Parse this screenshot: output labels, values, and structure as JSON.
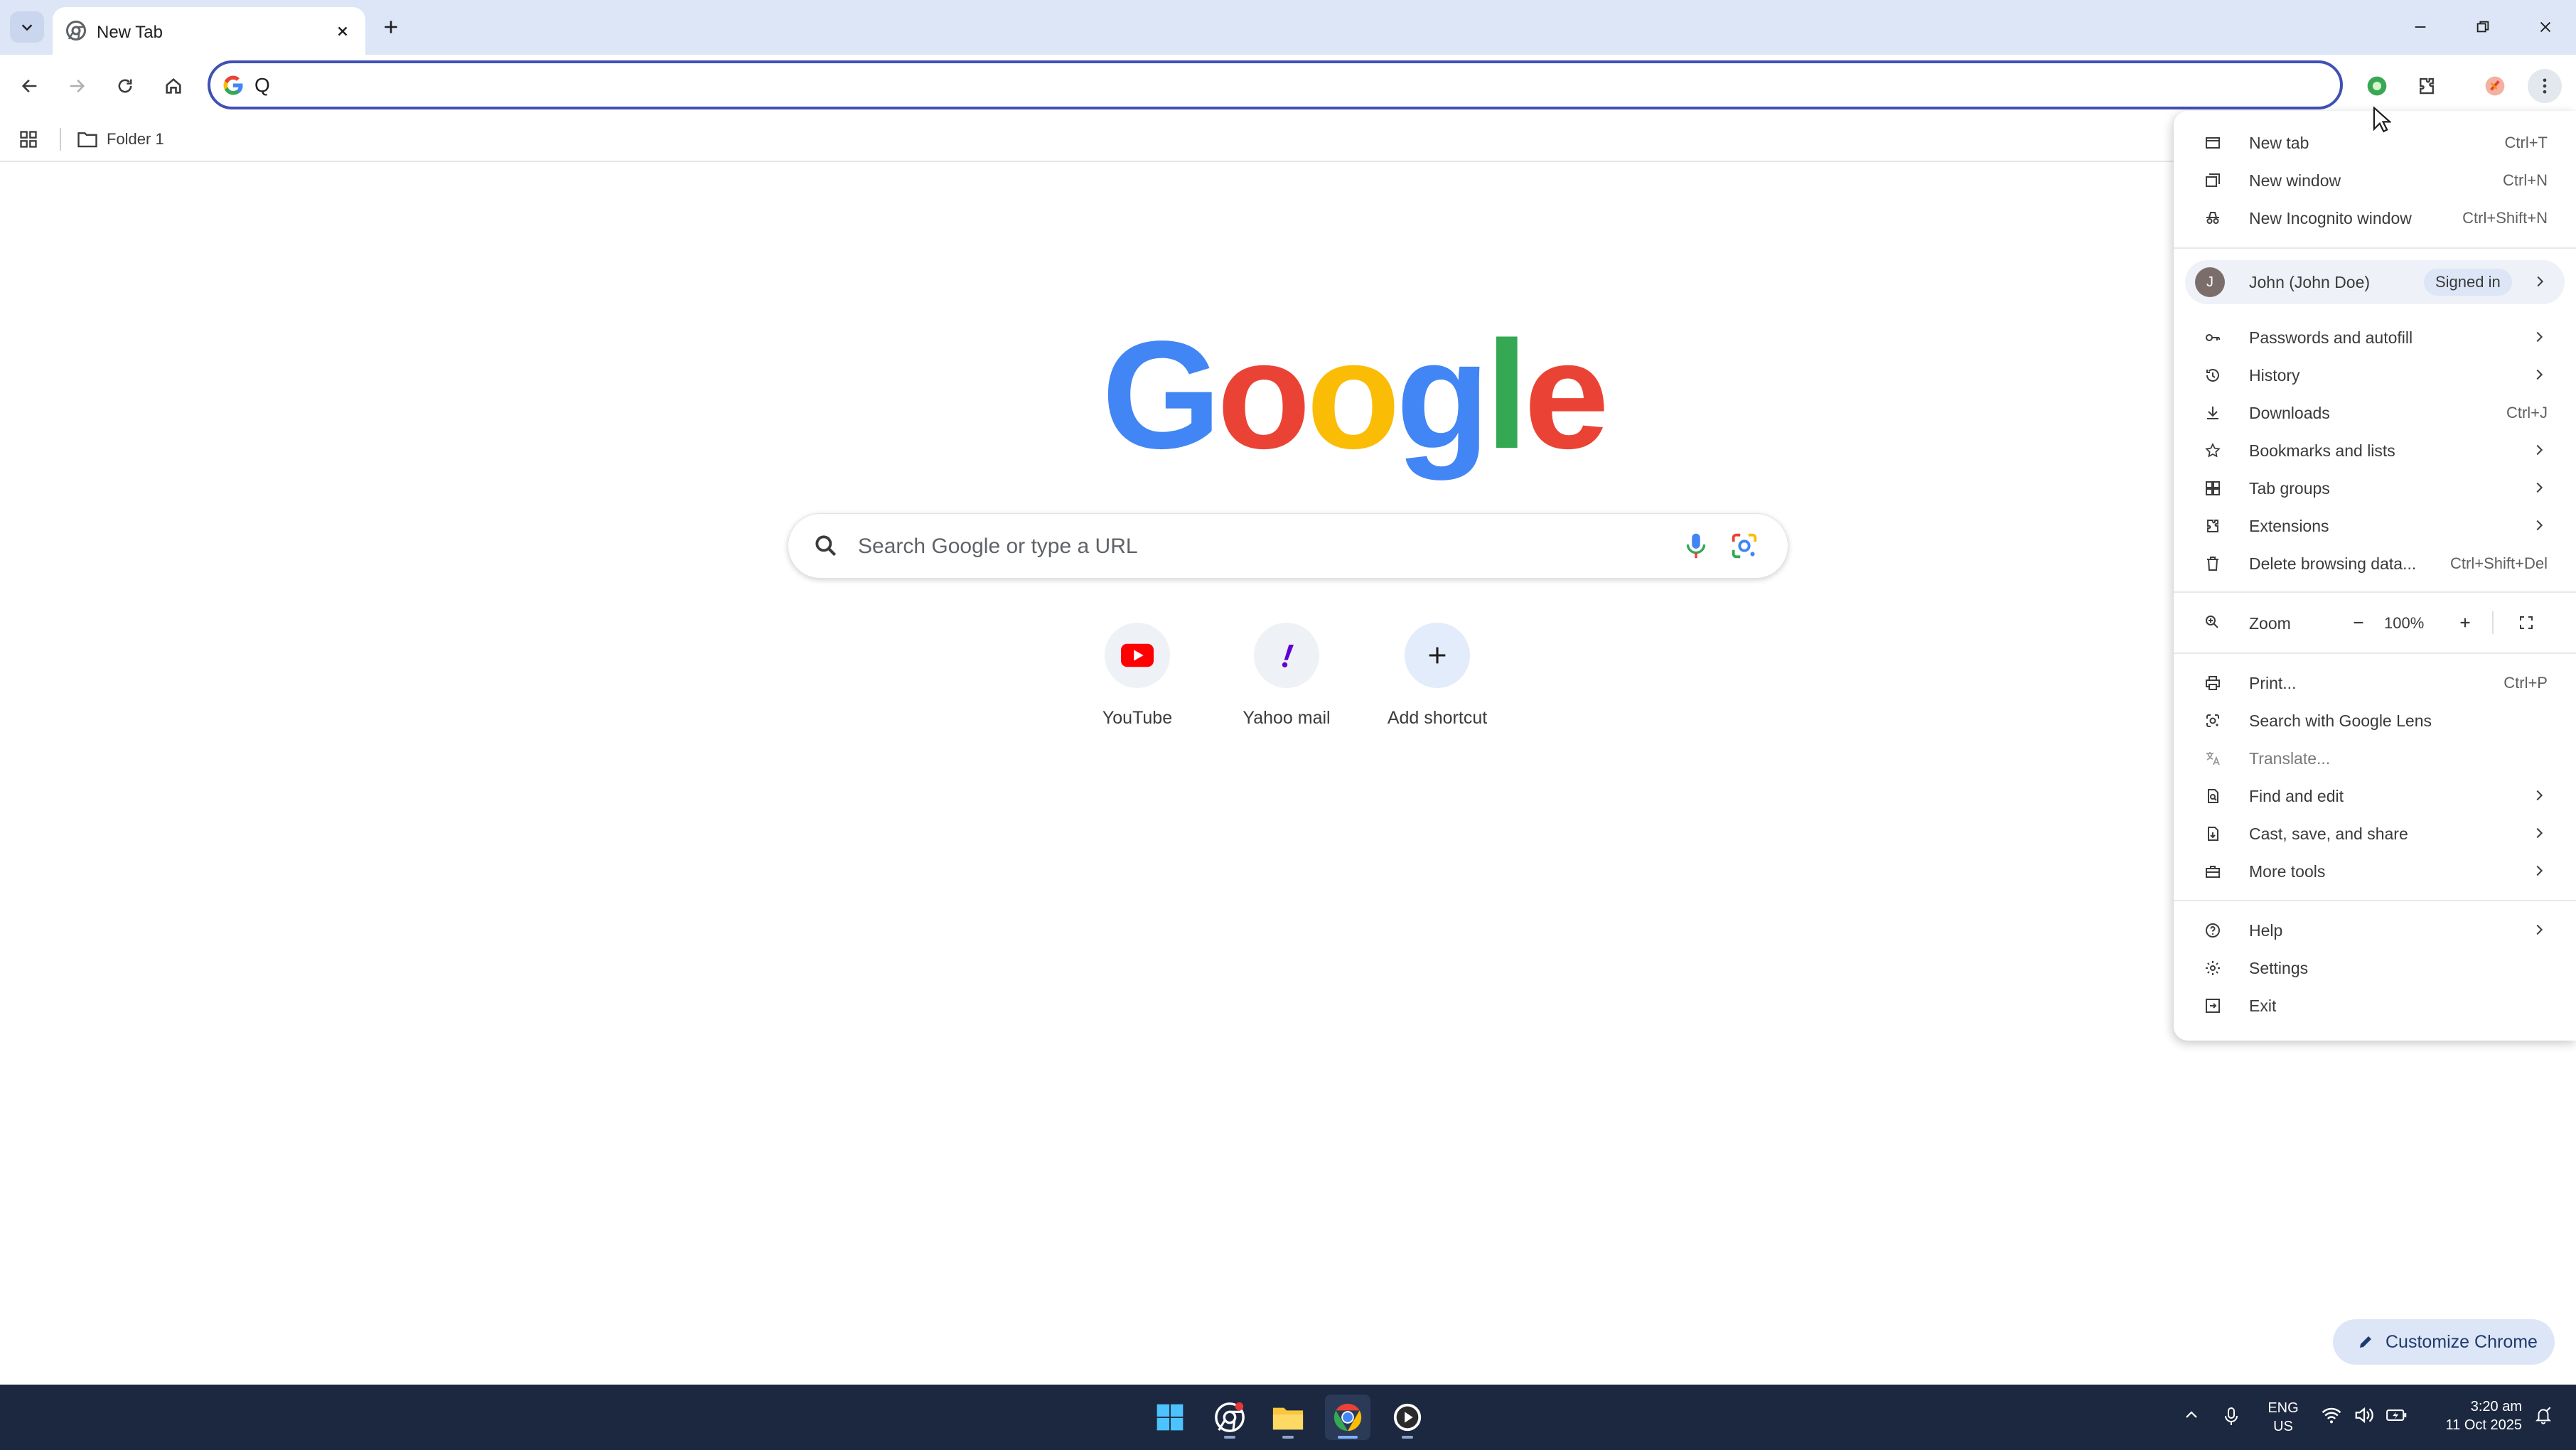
{
  "browser": {
    "tab_title": "New Tab",
    "omnibox_value": "Q"
  },
  "bookmarks": {
    "folder_label": "Folder 1"
  },
  "newtab": {
    "logo_letters": [
      {
        "char": "G",
        "color": "#4285F4"
      },
      {
        "char": "o",
        "color": "#EA4335"
      },
      {
        "char": "o",
        "color": "#FBBC05"
      },
      {
        "char": "g",
        "color": "#4285F4"
      },
      {
        "char": "l",
        "color": "#34A853"
      },
      {
        "char": "e",
        "color": "#EA4335"
      }
    ],
    "search_placeholder": "Search Google or type a URL",
    "shortcuts": [
      {
        "label": "YouTube",
        "icon": "youtube-icon"
      },
      {
        "label": "Yahoo mail",
        "icon": "yahoo-mail-icon"
      },
      {
        "label": "Add shortcut",
        "icon": "plus-icon"
      }
    ],
    "customize_label": "Customize Chrome"
  },
  "menu": {
    "new_tab": {
      "label": "New tab",
      "shortcut": "Ctrl+T"
    },
    "new_window": {
      "label": "New window",
      "shortcut": "Ctrl+N"
    },
    "new_incognito": {
      "label": "New Incognito window",
      "shortcut": "Ctrl+Shift+N"
    },
    "profile": {
      "initial": "J",
      "name": "John (John Doe)",
      "badge": "Signed in"
    },
    "passwords": {
      "label": "Passwords and autofill"
    },
    "history": {
      "label": "History"
    },
    "downloads": {
      "label": "Downloads",
      "shortcut": "Ctrl+J"
    },
    "bookmarks": {
      "label": "Bookmarks and lists"
    },
    "tab_groups": {
      "label": "Tab groups"
    },
    "extensions": {
      "label": "Extensions"
    },
    "delete_data": {
      "label": "Delete browsing data...",
      "shortcut": "Ctrl+Shift+Del"
    },
    "zoom": {
      "label": "Zoom",
      "value": "100%"
    },
    "print": {
      "label": "Print...",
      "shortcut": "Ctrl+P"
    },
    "lens": {
      "label": "Search with Google Lens"
    },
    "translate": {
      "label": "Translate..."
    },
    "find_edit": {
      "label": "Find and edit"
    },
    "cast": {
      "label": "Cast, save, and share"
    },
    "more_tools": {
      "label": "More tools"
    },
    "help": {
      "label": "Help"
    },
    "settings": {
      "label": "Settings"
    },
    "exit": {
      "label": "Exit"
    }
  },
  "taskbar": {
    "lang_line1": "ENG",
    "lang_line2": "US",
    "time": "3:20 am",
    "date": "11 Oct 2025"
  },
  "colors": {
    "accent": "#3f51b5",
    "tabstrip_bg": "#dde6f6",
    "taskbar_bg": "#1c2840",
    "youtube_red": "#FF0000",
    "yahoo_purple": "#6001D2"
  }
}
